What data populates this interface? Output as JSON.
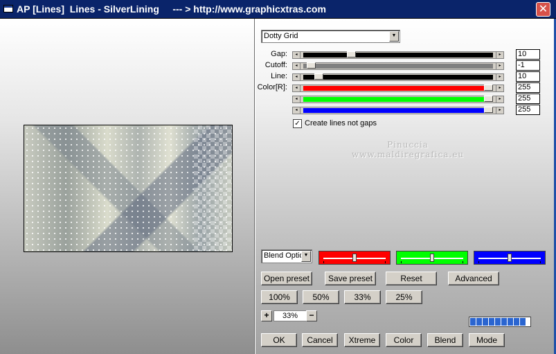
{
  "window": {
    "title": "AP [Lines]  Lines - SilverLining     --- > http://www.graphicxtras.com",
    "close_glyph": "✕"
  },
  "preset_dropdown": {
    "value": "Dotty Grid"
  },
  "sliders": [
    {
      "label": "Gap:",
      "value": "10",
      "fill": "black",
      "position": 0.24
    },
    {
      "label": "Cutoff:",
      "value": "-1",
      "fill": "gray",
      "position": 0.02
    },
    {
      "label": "Line:",
      "value": "10",
      "fill": "black",
      "position": 0.06
    },
    {
      "label": "Color[R]:",
      "value": "255",
      "fill": "red",
      "position": 1.0
    },
    {
      "label": "",
      "value": "255",
      "fill": "green",
      "position": 1.0
    },
    {
      "label": "",
      "value": "255",
      "fill": "blue",
      "position": 1.0
    }
  ],
  "checkbox": {
    "label": "Create lines not gaps",
    "checked": true,
    "mark": "✓"
  },
  "watermark": {
    "line1": "Pinuccia",
    "line2": "www.maldiregrafica.eu"
  },
  "blend_dropdown": {
    "value": "Blend Optio"
  },
  "color_boxes": [
    {
      "name": "red",
      "color": "#ff0000",
      "level": 0.5
    },
    {
      "name": "green",
      "color": "#00ff00",
      "level": 0.5
    },
    {
      "name": "blue",
      "color": "#0000ff",
      "level": 0.5
    }
  ],
  "buttons_row1": [
    "Open preset",
    "Save preset",
    "Reset",
    "Advanced"
  ],
  "buttons_row2": [
    "100%",
    "50%",
    "33%",
    "25%"
  ],
  "zoom": {
    "plus": "+",
    "value": "33%",
    "minus": "−"
  },
  "progress": {
    "segments": 9
  },
  "buttons_row3": [
    "OK",
    "Cancel",
    "Xtreme",
    "Color",
    "Blend",
    "Mode"
  ],
  "colors": {
    "titlebar": "#0a246a",
    "edge": "#1e4fa8"
  }
}
